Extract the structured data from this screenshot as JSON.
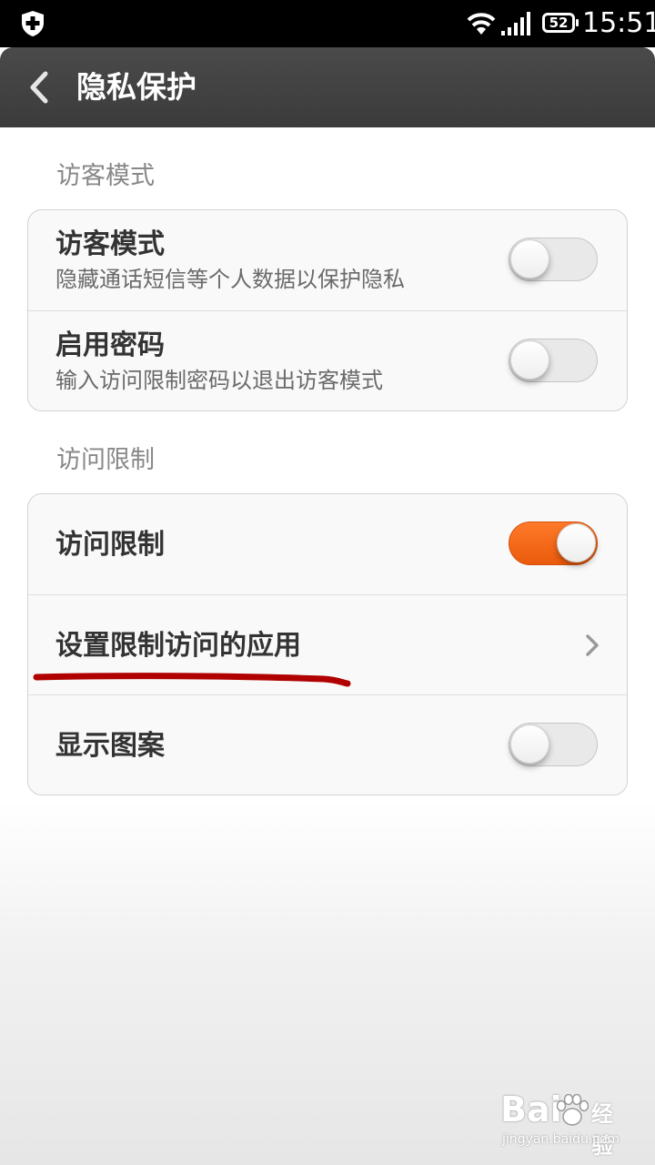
{
  "status_bar": {
    "battery": "52",
    "time": "15:51",
    "icons": [
      "shield-plus-icon",
      "wifi-icon",
      "signal-icon",
      "battery-icon"
    ]
  },
  "header": {
    "title": "隐私保护",
    "back_icon": "chevron-left-icon"
  },
  "sections": [
    {
      "header": "访客模式",
      "items": [
        {
          "title": "访客模式",
          "subtitle": "隐藏通话短信等个人数据以保护隐私",
          "control": "toggle",
          "on": false
        },
        {
          "title": "启用密码",
          "subtitle": "输入访问限制密码以退出访客模式",
          "control": "toggle",
          "on": false
        }
      ]
    },
    {
      "header": "访问限制",
      "items": [
        {
          "title": "访问限制",
          "control": "toggle",
          "on": true
        },
        {
          "title": "设置限制访问的应用",
          "control": "chevron"
        },
        {
          "title": "显示图案",
          "control": "toggle",
          "on": false
        }
      ]
    }
  ],
  "colors": {
    "accent": "#f26a1b",
    "annotation_underline": "#b00000",
    "header_bg": "#444444"
  },
  "watermark": {
    "brand": "Bai",
    "brand_suffix": "经验",
    "url": "jingyan.baidu.com"
  }
}
